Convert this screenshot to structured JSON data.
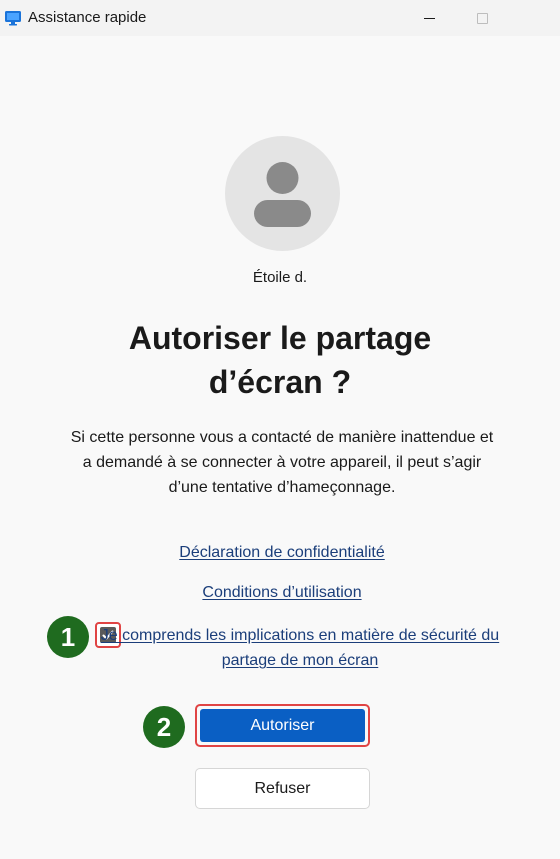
{
  "window": {
    "title": "Assistance rapide",
    "app_icon": "quick-assist-icon"
  },
  "requester": {
    "name": "Étoile d."
  },
  "prompt": {
    "title_line1": "Autoriser le partage",
    "title_line2": "d’écran ?",
    "description": "Si cette personne vous a contacté de manière inattendue et a demandé à se connecter à votre appareil, il peut s’agir d’une tentative d’hameçonnage."
  },
  "links": {
    "privacy": "Déclaration de confidentialité",
    "terms": "Conditions d’utilisation"
  },
  "consent": {
    "checked": true,
    "label": "Je comprends les implications en matière de sécurité du partage de mon écran"
  },
  "annotations": {
    "step1": "1",
    "step2": "2"
  },
  "buttons": {
    "allow": "Autoriser",
    "deny": "Refuser"
  },
  "colors": {
    "accent": "#0a5fc4",
    "link": "#1b3e7a",
    "highlight": "#e04444",
    "badge": "#1f6b1f"
  }
}
